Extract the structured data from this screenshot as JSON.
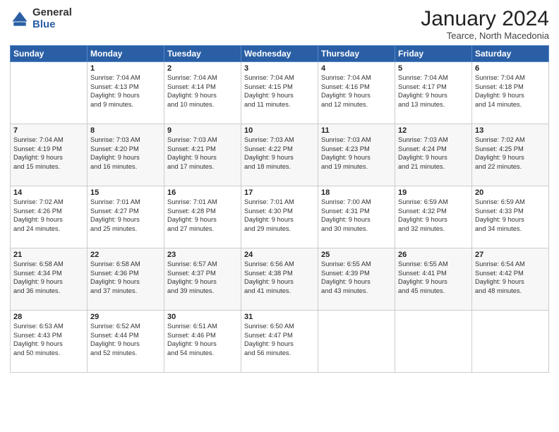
{
  "logo": {
    "general": "General",
    "blue": "Blue"
  },
  "header": {
    "month": "January 2024",
    "location": "Tearce, North Macedonia"
  },
  "days_of_week": [
    "Sunday",
    "Monday",
    "Tuesday",
    "Wednesday",
    "Thursday",
    "Friday",
    "Saturday"
  ],
  "weeks": [
    [
      {
        "day": "",
        "content": ""
      },
      {
        "day": "1",
        "content": "Sunrise: 7:04 AM\nSunset: 4:13 PM\nDaylight: 9 hours\nand 9 minutes."
      },
      {
        "day": "2",
        "content": "Sunrise: 7:04 AM\nSunset: 4:14 PM\nDaylight: 9 hours\nand 10 minutes."
      },
      {
        "day": "3",
        "content": "Sunrise: 7:04 AM\nSunset: 4:15 PM\nDaylight: 9 hours\nand 11 minutes."
      },
      {
        "day": "4",
        "content": "Sunrise: 7:04 AM\nSunset: 4:16 PM\nDaylight: 9 hours\nand 12 minutes."
      },
      {
        "day": "5",
        "content": "Sunrise: 7:04 AM\nSunset: 4:17 PM\nDaylight: 9 hours\nand 13 minutes."
      },
      {
        "day": "6",
        "content": "Sunrise: 7:04 AM\nSunset: 4:18 PM\nDaylight: 9 hours\nand 14 minutes."
      }
    ],
    [
      {
        "day": "7",
        "content": "Sunrise: 7:04 AM\nSunset: 4:19 PM\nDaylight: 9 hours\nand 15 minutes."
      },
      {
        "day": "8",
        "content": "Sunrise: 7:03 AM\nSunset: 4:20 PM\nDaylight: 9 hours\nand 16 minutes."
      },
      {
        "day": "9",
        "content": "Sunrise: 7:03 AM\nSunset: 4:21 PM\nDaylight: 9 hours\nand 17 minutes."
      },
      {
        "day": "10",
        "content": "Sunrise: 7:03 AM\nSunset: 4:22 PM\nDaylight: 9 hours\nand 18 minutes."
      },
      {
        "day": "11",
        "content": "Sunrise: 7:03 AM\nSunset: 4:23 PM\nDaylight: 9 hours\nand 19 minutes."
      },
      {
        "day": "12",
        "content": "Sunrise: 7:03 AM\nSunset: 4:24 PM\nDaylight: 9 hours\nand 21 minutes."
      },
      {
        "day": "13",
        "content": "Sunrise: 7:02 AM\nSunset: 4:25 PM\nDaylight: 9 hours\nand 22 minutes."
      }
    ],
    [
      {
        "day": "14",
        "content": "Sunrise: 7:02 AM\nSunset: 4:26 PM\nDaylight: 9 hours\nand 24 minutes."
      },
      {
        "day": "15",
        "content": "Sunrise: 7:01 AM\nSunset: 4:27 PM\nDaylight: 9 hours\nand 25 minutes."
      },
      {
        "day": "16",
        "content": "Sunrise: 7:01 AM\nSunset: 4:28 PM\nDaylight: 9 hours\nand 27 minutes."
      },
      {
        "day": "17",
        "content": "Sunrise: 7:01 AM\nSunset: 4:30 PM\nDaylight: 9 hours\nand 29 minutes."
      },
      {
        "day": "18",
        "content": "Sunrise: 7:00 AM\nSunset: 4:31 PM\nDaylight: 9 hours\nand 30 minutes."
      },
      {
        "day": "19",
        "content": "Sunrise: 6:59 AM\nSunset: 4:32 PM\nDaylight: 9 hours\nand 32 minutes."
      },
      {
        "day": "20",
        "content": "Sunrise: 6:59 AM\nSunset: 4:33 PM\nDaylight: 9 hours\nand 34 minutes."
      }
    ],
    [
      {
        "day": "21",
        "content": "Sunrise: 6:58 AM\nSunset: 4:34 PM\nDaylight: 9 hours\nand 36 minutes."
      },
      {
        "day": "22",
        "content": "Sunrise: 6:58 AM\nSunset: 4:36 PM\nDaylight: 9 hours\nand 37 minutes."
      },
      {
        "day": "23",
        "content": "Sunrise: 6:57 AM\nSunset: 4:37 PM\nDaylight: 9 hours\nand 39 minutes."
      },
      {
        "day": "24",
        "content": "Sunrise: 6:56 AM\nSunset: 4:38 PM\nDaylight: 9 hours\nand 41 minutes."
      },
      {
        "day": "25",
        "content": "Sunrise: 6:55 AM\nSunset: 4:39 PM\nDaylight: 9 hours\nand 43 minutes."
      },
      {
        "day": "26",
        "content": "Sunrise: 6:55 AM\nSunset: 4:41 PM\nDaylight: 9 hours\nand 45 minutes."
      },
      {
        "day": "27",
        "content": "Sunrise: 6:54 AM\nSunset: 4:42 PM\nDaylight: 9 hours\nand 48 minutes."
      }
    ],
    [
      {
        "day": "28",
        "content": "Sunrise: 6:53 AM\nSunset: 4:43 PM\nDaylight: 9 hours\nand 50 minutes."
      },
      {
        "day": "29",
        "content": "Sunrise: 6:52 AM\nSunset: 4:44 PM\nDaylight: 9 hours\nand 52 minutes."
      },
      {
        "day": "30",
        "content": "Sunrise: 6:51 AM\nSunset: 4:46 PM\nDaylight: 9 hours\nand 54 minutes."
      },
      {
        "day": "31",
        "content": "Sunrise: 6:50 AM\nSunset: 4:47 PM\nDaylight: 9 hours\nand 56 minutes."
      },
      {
        "day": "",
        "content": ""
      },
      {
        "day": "",
        "content": ""
      },
      {
        "day": "",
        "content": ""
      }
    ]
  ]
}
